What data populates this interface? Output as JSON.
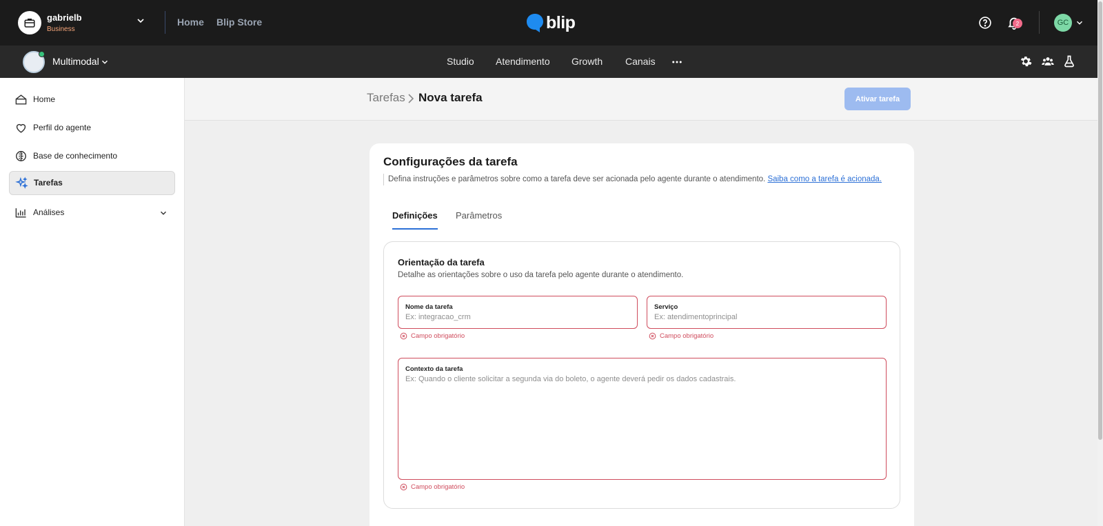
{
  "account": {
    "name": "gabrielb",
    "plan": "Business"
  },
  "topnav": {
    "home": "Home",
    "store": "Blip Store"
  },
  "logo": {
    "text": "blip",
    "brand_color": "#1e8bf0"
  },
  "notifications": {
    "count": "2"
  },
  "user": {
    "initials": "GC",
    "color": "#7dd8a6"
  },
  "bot": {
    "name": "Multimodal"
  },
  "subnav": {
    "items": [
      "Studio",
      "Atendimento",
      "Growth",
      "Canais"
    ]
  },
  "sidebar": {
    "items": [
      {
        "label": "Home",
        "icon": "home-icon"
      },
      {
        "label": "Perfil do agente",
        "icon": "heart-icon"
      },
      {
        "label": "Base de conhecimento",
        "icon": "brain-icon"
      },
      {
        "label": "Tarefas",
        "icon": "sparkles-icon",
        "active": true
      },
      {
        "label": "Análises",
        "icon": "bar-chart-icon"
      }
    ]
  },
  "breadcrumb": {
    "parent": "Tarefas",
    "current": "Nova tarefa"
  },
  "header": {
    "activate_label": "Ativar tarefa"
  },
  "card": {
    "title": "Configurações da tarefa",
    "description": "Defina instruções e parâmetros sobre como a tarefa deve ser acionada pelo agente durante o atendimento.",
    "link": "Saiba como a tarefa é acionada."
  },
  "tabs": [
    "Definições",
    "Parâmetros"
  ],
  "orientation": {
    "title": "Orientação da tarefa",
    "description": "Detalhe as orientações sobre o uso da tarefa pelo agente durante o atendimento."
  },
  "fields": {
    "name": {
      "label": "Nome da tarefa",
      "placeholder": "Ex: integracao_crm",
      "value": "",
      "error": "Campo obrigatório"
    },
    "service": {
      "label": "Serviço",
      "placeholder": "Ex: atendimentoprincipal",
      "value": "",
      "error": "Campo obrigatório"
    },
    "context": {
      "label": "Contexto da tarefa",
      "placeholder": "Ex: Quando o cliente solicitar a segunda via do boleto, o agente deverá pedir os dados cadastrais.",
      "value": "",
      "error": "Campo obrigatório"
    }
  },
  "colors": {
    "accent": "#2b6fd6",
    "error": "#cf4b5c",
    "button_disabled": "#9dbbf0"
  }
}
